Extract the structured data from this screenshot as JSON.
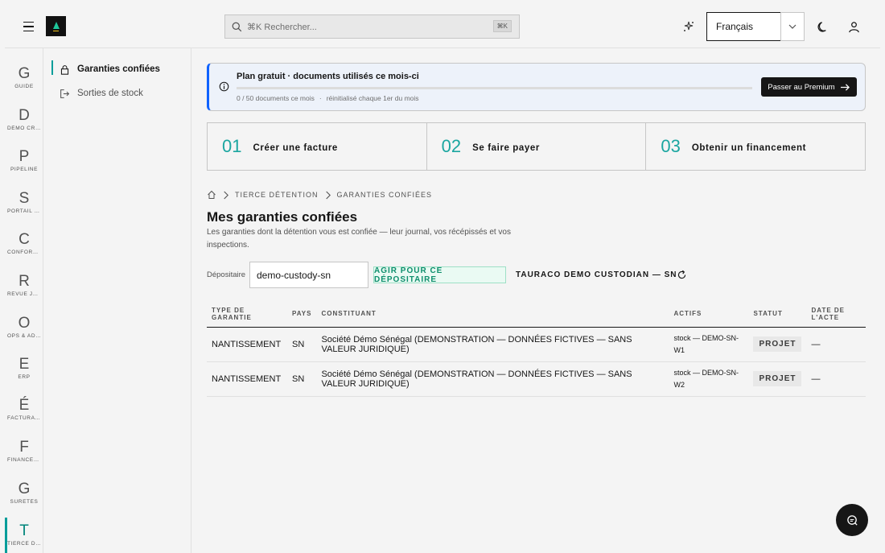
{
  "header": {
    "search_placeholder": "⌘K Rechercher...",
    "search_kbd": "⌘K",
    "language": "Français"
  },
  "rail": [
    {
      "letter": "G",
      "label": "GUIDE"
    },
    {
      "letter": "D",
      "label": "DÉMO CRUD"
    },
    {
      "letter": "P",
      "label": "PIPELINE"
    },
    {
      "letter": "S",
      "label": "PORTAIL V…"
    },
    {
      "letter": "C",
      "label": "CONFORM…"
    },
    {
      "letter": "R",
      "label": "REVUE JU…"
    },
    {
      "letter": "O",
      "label": "OPS & AD…"
    },
    {
      "letter": "E",
      "label": "ERP"
    },
    {
      "letter": "É",
      "label": "FACTURAT…"
    },
    {
      "letter": "F",
      "label": "FINANCEM…"
    },
    {
      "letter": "G",
      "label": "SÛRETÉS"
    },
    {
      "letter": "T",
      "label": "TIERCE DÉ…"
    }
  ],
  "subnav": [
    {
      "label": "Garanties confiées"
    },
    {
      "label": "Sorties de stock"
    }
  ],
  "banner": {
    "title": "Plan gratuit · documents utilisés ce mois-ci",
    "usage": "0 / 50 documents ce mois",
    "reset": "réinitialisé chaque 1er du mois",
    "cta": "Passer au Premium",
    "progress": 0
  },
  "steps": [
    {
      "num": "01",
      "label": "Créer une facture"
    },
    {
      "num": "02",
      "label": "Se faire payer"
    },
    {
      "num": "03",
      "label": "Obtenir un financement"
    }
  ],
  "breadcrumb": [
    "TIERCE DÉTENTION",
    "GARANTIES CONFIÉES"
  ],
  "page": {
    "title": "Mes garanties confiées",
    "description": "Les garanties dont la détention vous est confiée — leur journal, vos récépissés et vos inspections."
  },
  "filter": {
    "label": "Dépositaire",
    "value": "demo-custody-sn",
    "action": "AGIR POUR CE DÉPOSITAIRE",
    "custodian": "TAURACO DEMO CUSTODIAN — SN"
  },
  "table": {
    "headers": [
      "TYPE DE GARANTIE",
      "PAYS",
      "CONSTITUANT",
      "ACTIFS",
      "STATUT",
      "DATE DE L'ACTE"
    ],
    "rows": [
      [
        "NANTISSEMENT",
        "SN",
        "Société Démo Sénégal (DEMONSTRATION — DONNÉES FICTIVES — SANS VALEUR JURIDIQUE)",
        "stock — DEMO-SN-W1",
        "PROJET",
        "—"
      ],
      [
        "NANTISSEMENT",
        "SN",
        "Société Démo Sénégal (DEMONSTRATION — DONNÉES FICTIVES — SANS VALEUR JURIDIQUE)",
        "stock — DEMO-SN-W2",
        "PROJET",
        "—"
      ]
    ]
  },
  "colors": {
    "accent": "#009d9a",
    "brand": "#1ec69a",
    "info": "#0f62fe"
  }
}
